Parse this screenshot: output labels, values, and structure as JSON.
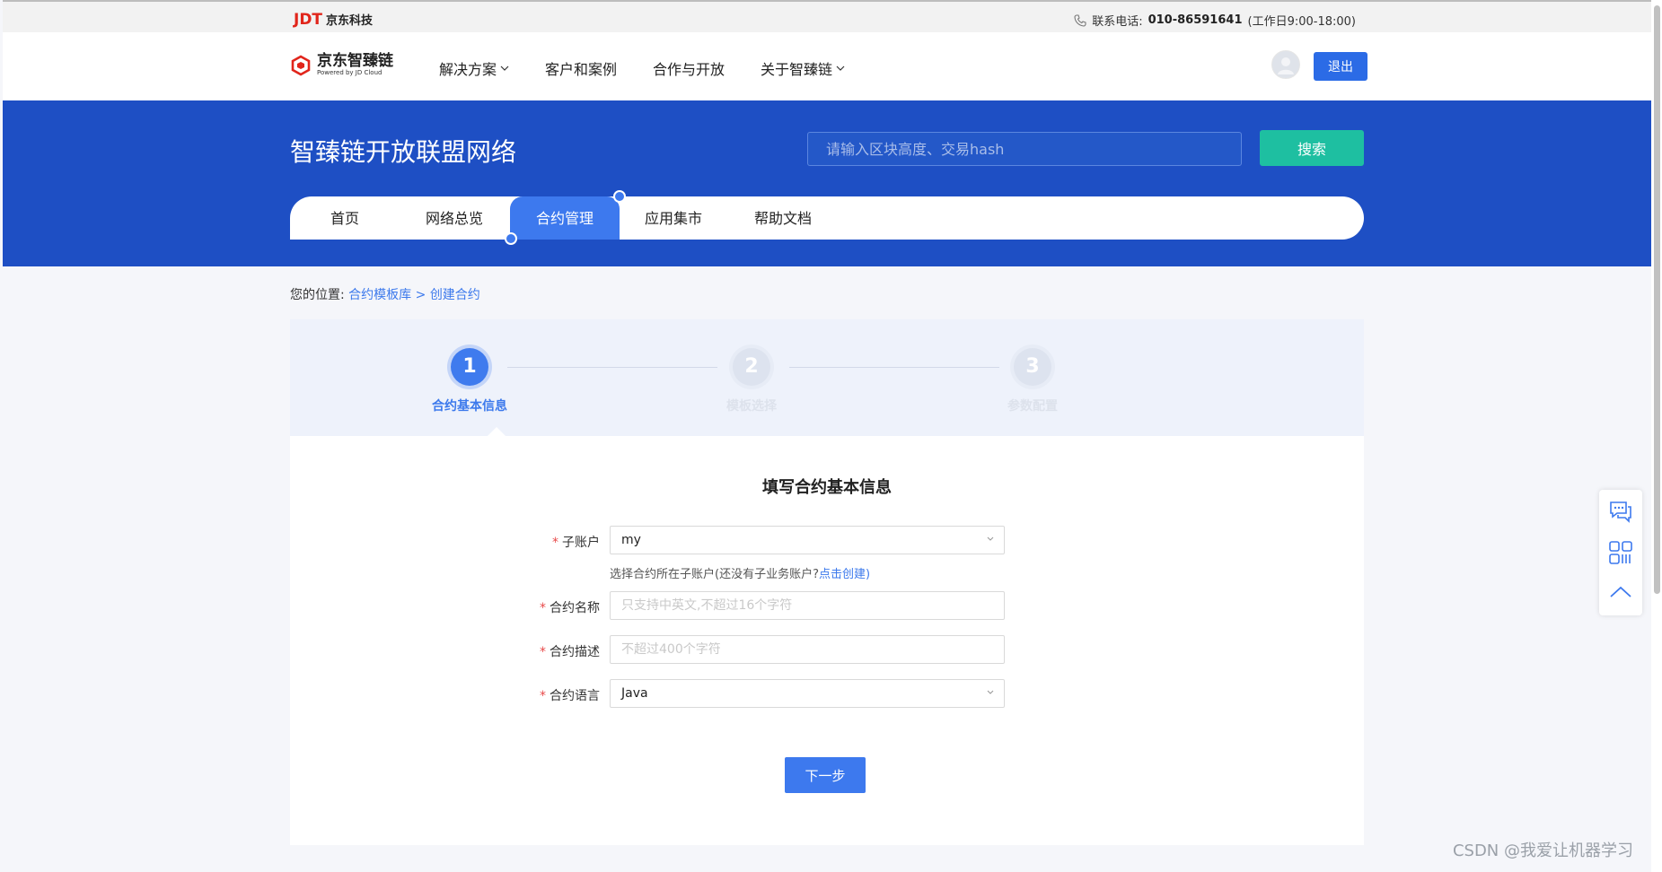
{
  "topbar": {
    "logo_text": "JDT",
    "logo_sub": "京东科技",
    "contact_label": "联系电话:",
    "contact_phone": "010-86591641",
    "contact_hours": "(工作日9:00-18:00)"
  },
  "nav": {
    "brand_name": "京东智臻链",
    "brand_sub": "Powered by JD Cloud",
    "menu": [
      {
        "label": "解决方案",
        "has_dropdown": true
      },
      {
        "label": "客户和案例",
        "has_dropdown": false
      },
      {
        "label": "合作与开放",
        "has_dropdown": false
      },
      {
        "label": "关于智臻链",
        "has_dropdown": true
      }
    ],
    "logout_label": "退出"
  },
  "banner": {
    "title": "智臻链开放联盟网络",
    "search_placeholder": "请输入区块高度、交易hash",
    "search_button": "搜索"
  },
  "tabs": [
    {
      "label": "首页",
      "active": false
    },
    {
      "label": "网络总览",
      "active": false
    },
    {
      "label": "合约管理",
      "active": true
    },
    {
      "label": "应用集市",
      "active": false
    },
    {
      "label": "帮助文档",
      "active": false
    }
  ],
  "breadcrumb": {
    "prefix": "您的位置:",
    "items": [
      "合约模板库",
      "创建合约"
    ],
    "separator": ">"
  },
  "steps": [
    {
      "number": "1",
      "label": "合约基本信息",
      "active": true
    },
    {
      "number": "2",
      "label": "模板选择",
      "active": false
    },
    {
      "number": "3",
      "label": "参数配置",
      "active": false
    }
  ],
  "form": {
    "title": "填写合约基本信息",
    "sub_account": {
      "label": "子账户",
      "value": "my",
      "hint": "选择合约所在子账户(还没有子业务账户?",
      "hint_link": "点击创建",
      "hint_end": ")"
    },
    "contract_name": {
      "label": "合约名称",
      "placeholder": "只支持中英文,不超过16个字符"
    },
    "contract_desc": {
      "label": "合约描述",
      "placeholder": "不超过400个字符"
    },
    "contract_lang": {
      "label": "合约语言",
      "value": "Java"
    },
    "required_mark": "*",
    "next_button": "下一步"
  },
  "watermark": "CSDN @我爱让机器学习",
  "colors": {
    "primary": "#3d79ee",
    "banner": "#1e4fc4",
    "search_button": "#1ebfa1",
    "logo_red": "#e1251b"
  }
}
